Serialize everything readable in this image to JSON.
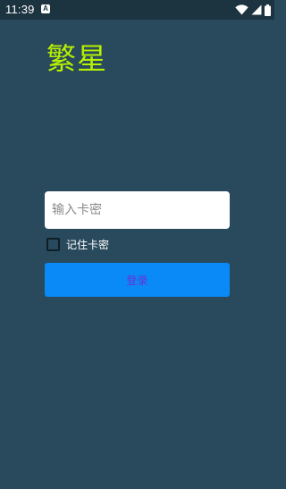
{
  "status_bar": {
    "time": "11:39",
    "notification_icon": "A",
    "icons": [
      "wifi-icon",
      "signal-icon",
      "battery-icon"
    ]
  },
  "app": {
    "title": "繁星"
  },
  "login_form": {
    "card_input": {
      "placeholder": "输入卡密",
      "value": ""
    },
    "remember_label": "记住卡密",
    "remember_checked": false,
    "login_label": "登录"
  },
  "colors": {
    "background": "#284a5c",
    "status_bar": "#1c3340",
    "title": "#b7f000",
    "button": "#0a8af7",
    "button_text": "#6b2fd6"
  }
}
